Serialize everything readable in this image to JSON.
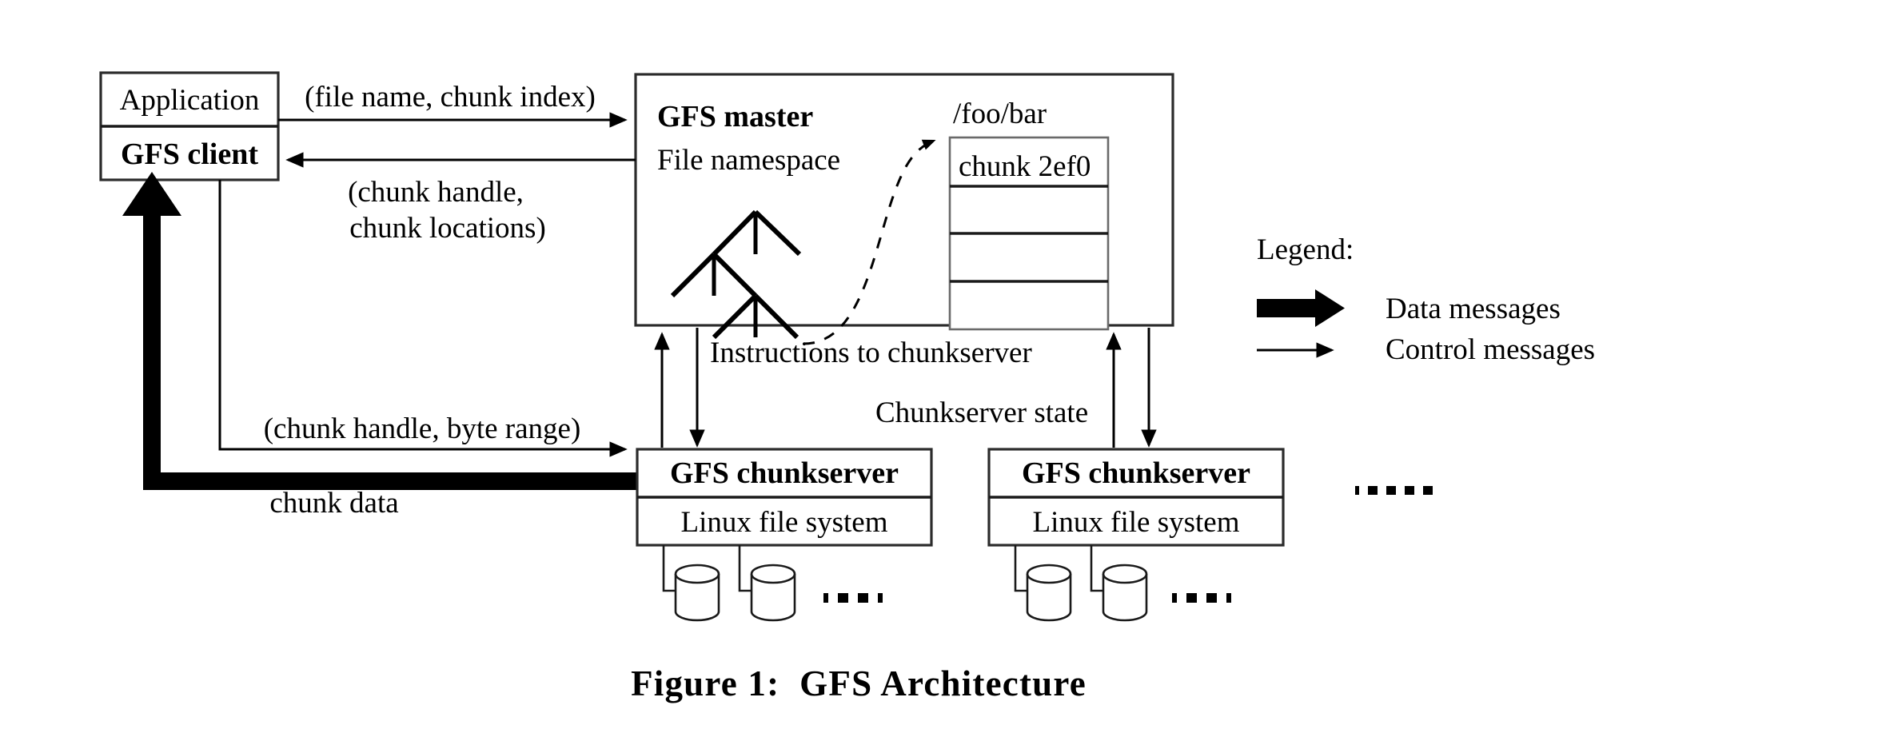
{
  "figure": {
    "caption": "Figure 1:  GFS Architecture"
  },
  "client_stack": {
    "application_label": "Application",
    "gfs_client_label": "GFS client"
  },
  "master": {
    "title": "GFS master",
    "namespace_label": "File namespace",
    "file_path": "/foo/bar",
    "chunk_table": {
      "rows": [
        "chunk 2ef0",
        "",
        "",
        ""
      ]
    }
  },
  "chunkservers": [
    {
      "title": "GFS chunkserver",
      "filesystem_label": "Linux file system",
      "disk_count": 2,
      "ellipsis": "▪ ▪ ▪ ▪"
    },
    {
      "title": "GFS chunkserver",
      "filesystem_label": "Linux file system",
      "disk_count": 2,
      "ellipsis": "▪ ▪ ▪ ▪"
    }
  ],
  "more_chunkservers_ellipsis": "▪ ▪ ▪ ▪ ▪",
  "edges": {
    "client_to_master": "(file name, chunk index)",
    "master_to_client_line1": "(chunk handle,",
    "master_to_client_line2": "chunk locations)",
    "client_to_chunkserver": "(chunk handle, byte range)",
    "chunkserver_to_client": "chunk data",
    "master_to_chunkserver": "Instructions to chunkserver",
    "chunkserver_to_master": "Chunkserver state"
  },
  "legend": {
    "title": "Legend:",
    "items": [
      {
        "label": "Data messages",
        "kind": "thick-arrow"
      },
      {
        "label": "Control messages",
        "kind": "thin-arrow"
      }
    ]
  },
  "colors": {
    "ink": "#000000",
    "stroke": "#1a1a1a",
    "background": "#ffffff"
  }
}
